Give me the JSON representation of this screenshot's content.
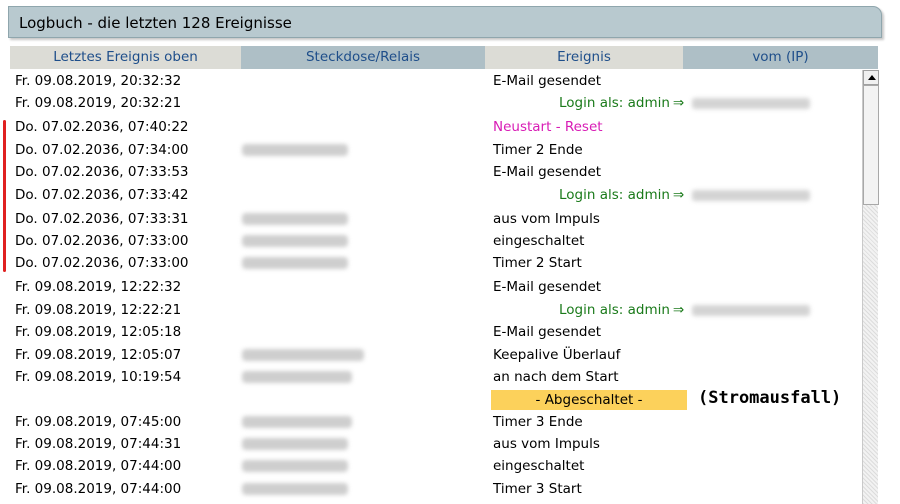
{
  "title": "Logbuch - die letzten 128 Ereignisse",
  "columns": [
    "Letztes Ereignis oben",
    "Steckdose/Relais",
    "Ereignis",
    "vom (IP)"
  ],
  "rows": [
    {
      "date": "Fr. 09.08.2019, 20:32:32",
      "event": "E-Mail gesendet",
      "style": "normal",
      "device_blurred": false,
      "ip_blurred": false
    },
    {
      "date": "Fr. 09.08.2019, 20:32:21",
      "event": "Login als: admin",
      "style": "login",
      "device_blurred": false,
      "ip_blurred": true
    },
    {
      "date": "Do. 07.02.2036, 07:40:22",
      "event": "Neustart - Reset",
      "style": "reset",
      "device_blurred": false,
      "ip_blurred": false
    },
    {
      "date": "Do. 07.02.2036, 07:34:00",
      "event": "Timer 2 Ende",
      "style": "normal",
      "device_blurred": true,
      "ip_blurred": false
    },
    {
      "date": "Do. 07.02.2036, 07:33:53",
      "event": "E-Mail gesendet",
      "style": "normal",
      "device_blurred": false,
      "ip_blurred": false
    },
    {
      "date": "Do. 07.02.2036, 07:33:42",
      "event": "Login als: admin",
      "style": "login",
      "device_blurred": false,
      "ip_blurred": true
    },
    {
      "date": "Do. 07.02.2036, 07:33:31",
      "event": "aus vom Impuls",
      "style": "normal",
      "device_blurred": true,
      "ip_blurred": false
    },
    {
      "date": "Do. 07.02.2036, 07:33:00",
      "event": "eingeschaltet",
      "style": "normal",
      "device_blurred": true,
      "ip_blurred": false
    },
    {
      "date": "Do. 07.02.2036, 07:33:00",
      "event": "Timer 2 Start",
      "style": "normal",
      "device_blurred": true,
      "ip_blurred": false
    },
    {
      "date": "Fr. 09.08.2019, 12:22:32",
      "event": "E-Mail gesendet",
      "style": "normal",
      "device_blurred": false,
      "ip_blurred": false
    },
    {
      "date": "Fr. 09.08.2019, 12:22:21",
      "event": "Login als: admin",
      "style": "login",
      "device_blurred": false,
      "ip_blurred": true
    },
    {
      "date": "Fr. 09.08.2019, 12:05:18",
      "event": "E-Mail gesendet",
      "style": "normal",
      "device_blurred": false,
      "ip_blurred": false
    },
    {
      "date": "Fr. 09.08.2019, 12:05:07",
      "event": "Keepalive Überlauf",
      "style": "normal",
      "device_blurred": true,
      "ip_blurred": false
    },
    {
      "date": "Fr. 09.08.2019, 10:19:54",
      "event": "an nach dem Start",
      "style": "normal",
      "device_blurred": true,
      "ip_blurred": false
    },
    {
      "date": "",
      "event": "- Abgeschaltet -",
      "style": "off",
      "device_blurred": false,
      "ip_blurred": false,
      "annotation": "(Stromausfall)"
    },
    {
      "date": "Fr. 09.08.2019, 07:45:00",
      "event": "Timer 3 Ende",
      "style": "normal",
      "device_blurred": true,
      "ip_blurred": false
    },
    {
      "date": "Fr. 09.08.2019, 07:44:31",
      "event": "aus vom Impuls",
      "style": "normal",
      "device_blurred": true,
      "ip_blurred": false
    },
    {
      "date": "Fr. 09.08.2019, 07:44:00",
      "event": "eingeschaltet",
      "style": "normal",
      "device_blurred": true,
      "ip_blurred": false
    },
    {
      "date": "Fr. 09.08.2019, 07:44:00",
      "event": "Timer 3 Start",
      "style": "normal",
      "device_blurred": true,
      "ip_blurred": false
    }
  ],
  "login_arrow": "⇒",
  "colors": {
    "login": "#1a7a1a",
    "reset": "#d81cb5",
    "off_bar": "#fcd15b",
    "header_text": "#1e4e8a",
    "marker": "#e02020"
  }
}
